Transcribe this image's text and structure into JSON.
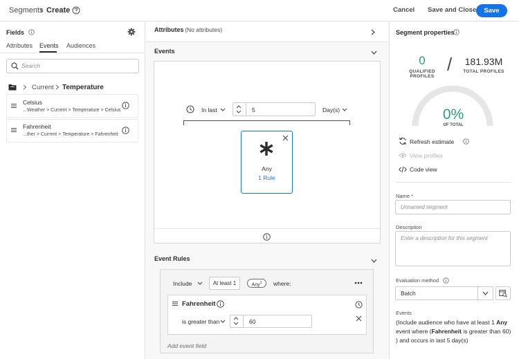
{
  "header": {
    "breadcrumb_root": "Segments",
    "breadcrumb_current": "Create",
    "cancel_label": "Cancel",
    "save_close_label": "Save and Close",
    "save_label": "Save"
  },
  "fields_panel": {
    "title": "Fields",
    "tabs": [
      {
        "label": "Attributes",
        "active": false
      },
      {
        "label": "Events",
        "active": true
      },
      {
        "label": "Audiences",
        "active": false
      }
    ],
    "search_placeholder": "Search",
    "path": {
      "parent": "Current",
      "current": "Temperature"
    },
    "items": [
      {
        "name": "Celsius",
        "path": "...Weather > Current > Temperature > Celsius"
      },
      {
        "name": "Fahrenheit",
        "path": "...ther > Current > Temperature > Fahrenheit"
      }
    ]
  },
  "attributes_section": {
    "title": "Attributes",
    "subtitle": " - (No attributes)"
  },
  "events_section": {
    "title": "Events",
    "time_mode": "In last",
    "time_value": "5",
    "time_unit": "Day(s)",
    "card": {
      "label": "Any",
      "rule_link": "1 Rule"
    }
  },
  "event_rules": {
    "title": "Event Rules",
    "include_label": "Include",
    "count_label": "At least 1",
    "any_pill": "Any",
    "any_pill_sup": "1",
    "where_label": "where:",
    "rule": {
      "field": "Fahrenheit",
      "operator": "is greater than",
      "value": "60"
    },
    "add_field": "Add event field"
  },
  "segment_properties": {
    "title": "Segment properties",
    "qualified_count": "0",
    "qualified_label": "QUALIFIED PROFILES",
    "total_count": "181.93M",
    "total_label": "TOTAL PROFILES",
    "percent": "0%",
    "percent_value": 0,
    "percent_label": "OF TOTAL",
    "refresh_label": "Refresh estimate",
    "view_profiles_label": "View profiles",
    "code_view_label": "Code view",
    "name_label": "Name *",
    "name_placeholder": "Unnamed segment",
    "description_label": "Description",
    "description_placeholder": "Enter a description for this segment",
    "evaluation_label": "Evaluation method",
    "evaluation_value": "Batch",
    "events_label": "Events",
    "events_description": {
      "p1": "(Include audience who have at least 1 ",
      "b1": "Any",
      "p2": " event where (",
      "b2": "Fahrenheit",
      "p3": " is greater than 60) ) and occurs in last 5 day(s)"
    }
  },
  "colors": {
    "accent": "#1473e6",
    "success": "#2d9d78",
    "gauge_track": "#e6e6e6"
  }
}
